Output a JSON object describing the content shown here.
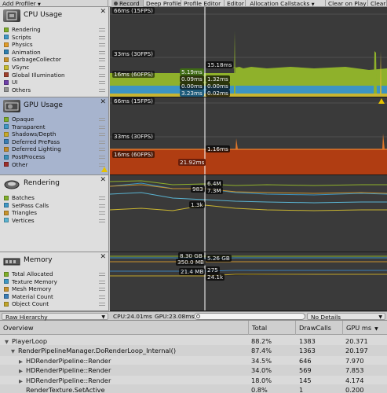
{
  "toolbar": {
    "items": [
      "Add Profiler",
      "Record",
      "Deep Profile",
      "Profile Editor",
      "Editor",
      "Allocation Callstacks",
      "Clear on Play",
      "Clear"
    ]
  },
  "modules": {
    "cpu": {
      "title": "CPU Usage",
      "legend": [
        {
          "label": "Rendering",
          "color": "#7fae2a"
        },
        {
          "label": "Scripts",
          "color": "#3f97c4"
        },
        {
          "label": "Physics",
          "color": "#e09c2b"
        },
        {
          "label": "Animation",
          "color": "#2f7fb0"
        },
        {
          "label": "GarbageCollector",
          "color": "#c7932d"
        },
        {
          "label": "VSync",
          "color": "#c7bc2f"
        },
        {
          "label": "Global Illumination",
          "color": "#9e3f2c"
        },
        {
          "label": "UI",
          "color": "#6f3fa8"
        },
        {
          "label": "Others",
          "color": "#949494"
        }
      ]
    },
    "gpu": {
      "title": "GPU Usage",
      "legend": [
        {
          "label": "Opaque",
          "color": "#7fae2a"
        },
        {
          "label": "Transparent",
          "color": "#3f97c4"
        },
        {
          "label": "Shadows/Depth",
          "color": "#c8aa2b"
        },
        {
          "label": "Deferred PrePass",
          "color": "#3a7db5"
        },
        {
          "label": "Deferred Lighting",
          "color": "#c08b2a"
        },
        {
          "label": "PostProcess",
          "color": "#3b8fb9"
        },
        {
          "label": "Other",
          "color": "#9c2f2c"
        }
      ]
    },
    "rendering": {
      "title": "Rendering",
      "legend": [
        {
          "label": "Batches",
          "color": "#7fae2a"
        },
        {
          "label": "SetPass Calls",
          "color": "#3f97c4"
        },
        {
          "label": "Triangles",
          "color": "#c7932d"
        },
        {
          "label": "Vertices",
          "color": "#5ab3d1"
        }
      ]
    },
    "memory": {
      "title": "Memory",
      "legend": [
        {
          "label": "Total Allocated",
          "color": "#7fae2a"
        },
        {
          "label": "Texture Memory",
          "color": "#3f97c4"
        },
        {
          "label": "Mesh Memory",
          "color": "#c7932d"
        },
        {
          "label": "Material Count",
          "color": "#3a7db5"
        },
        {
          "label": "Object Count",
          "color": "#c0a42a"
        }
      ]
    }
  },
  "graphs": {
    "cpu": {
      "thresholds": [
        "66ms (15FPS)",
        "33ms (30FPS)",
        "16ms (60FPS)"
      ],
      "values_left": [
        "5.19ms",
        "0.09ms",
        "0.00ms",
        "3.23ms"
      ],
      "values_right": [
        "15.18ms",
        "1.32ms",
        "0.00ms",
        "0.02ms"
      ]
    },
    "gpu": {
      "thresholds": [
        "66ms (15FPS)",
        "33ms (30FPS)",
        "16ms (60FPS)"
      ],
      "values": [
        "21.92ms",
        "1.16ms"
      ]
    },
    "rendering": {
      "values": [
        "6.4M",
        "983",
        "7.3M",
        "1.3k"
      ]
    },
    "memory": {
      "values": [
        "8.30 GB",
        "5.26 GB",
        "350.0 MB",
        "21.4 MB",
        "275",
        "24.1k"
      ]
    }
  },
  "bottom_bar": {
    "view_mode": "Raw Hierarchy",
    "cpu_time": "CPU:24.01ms",
    "gpu_time": "GPU:23.08ms",
    "details_mode": "No Details"
  },
  "table": {
    "columns": [
      "Overview",
      "Total",
      "DrawCalls",
      "GPU ms"
    ],
    "rows": [
      {
        "name": "PlayerLoop",
        "total": "88.2%",
        "drawcalls": "1383",
        "gpu_ms": "20.371"
      },
      {
        "name": "RenderPipelineManager.DoRenderLoop_Internal()",
        "total": "87.4%",
        "drawcalls": "1363",
        "gpu_ms": "20.197"
      },
      {
        "name": "HDRenderPipeline::Render",
        "total": "34.5%",
        "drawcalls": "646",
        "gpu_ms": "7.970"
      },
      {
        "name": "HDRenderPipeline::Render",
        "total": "34.0%",
        "drawcalls": "569",
        "gpu_ms": "7.853"
      },
      {
        "name": "HDRenderPipeline::Render",
        "total": "18.0%",
        "drawcalls": "145",
        "gpu_ms": "4.174"
      },
      {
        "name": "RenderTexture.SetActive",
        "total": "0.8%",
        "drawcalls": "1",
        "gpu_ms": "0.200"
      }
    ]
  }
}
